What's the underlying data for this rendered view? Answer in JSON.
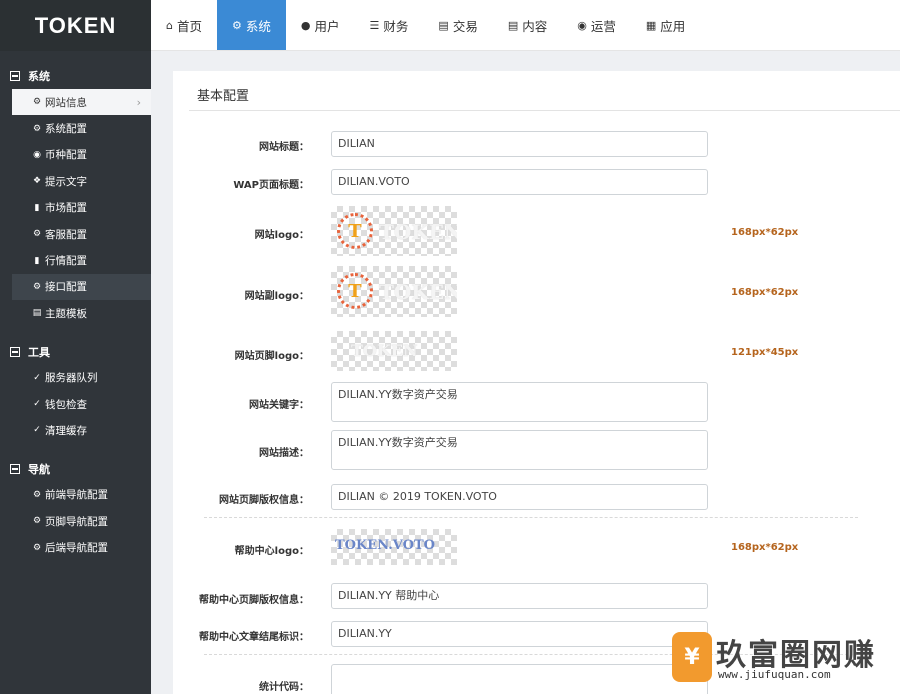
{
  "logo": "TOKEN",
  "topnav": [
    {
      "label": "首页",
      "icon": "home-icon"
    },
    {
      "label": "系统",
      "icon": "gear-icon"
    },
    {
      "label": "用户",
      "icon": "user-icon"
    },
    {
      "label": "财务",
      "icon": "list-icon"
    },
    {
      "label": "交易",
      "icon": "bar-chart-icon"
    },
    {
      "label": "内容",
      "icon": "document-icon"
    },
    {
      "label": "运营",
      "icon": "globe-icon"
    },
    {
      "label": "应用",
      "icon": "grid-icon"
    }
  ],
  "sidebar": {
    "group_system": "系统",
    "system_items": [
      "网站信息",
      "系统配置",
      "币种配置",
      "提示文字",
      "市场配置",
      "客服配置",
      "行情配置",
      "接口配置",
      "主题模板"
    ],
    "group_tools": "工具",
    "tools_items": [
      "服务器队列",
      "钱包检查",
      "清理缓存"
    ],
    "group_nav": "导航",
    "nav_items": [
      "前端导航配置",
      "页脚导航配置",
      "后端导航配置"
    ]
  },
  "panel": {
    "title": "基本配置",
    "labels": {
      "site_title": "网站标题：",
      "wap_title": "WAP页面标题：",
      "site_logo": "网站logo：",
      "site_sublogo": "网站副logo：",
      "footer_logo": "网站页脚logo：",
      "keywords": "网站关键字：",
      "description": "网站描述：",
      "copyright": "网站页脚版权信息：",
      "help_logo": "帮助中心logo：",
      "help_copyright": "帮助中心页脚版权信息：",
      "help_article_tail": "帮助中心文章结尾标识：",
      "stats_code": "统计代码："
    },
    "values": {
      "site_title": "DILIAN",
      "wap_title": "DILIAN.VOTO",
      "keywords": "DILIAN.YY数字资产交易",
      "description": "DILIAN.YY数字资产交易",
      "copyright": "DILIAN © 2019 TOKEN.VOTO",
      "help_copyright": "DILIAN.YY 帮助中心",
      "help_article_tail": "DILIAN.YY"
    },
    "logo_texts": {
      "site_logo": "TOKEN",
      "site_sublogo": "TOKEN",
      "footer_logo": "TOKEN",
      "help_logo": "TOKEN.VOTO"
    },
    "sizes": {
      "site_logo": "168px*62px",
      "site_sublogo": "168px*62px",
      "footer_logo": "121px*45px",
      "help_logo": "168px*62px"
    }
  },
  "watermark": {
    "badge": "¥",
    "title": "玖富圈网赚",
    "url": "www.jiufuquan.com"
  },
  "colors": {
    "active_nav": "#3b8ad5",
    "sidebar_bg": "#30353a",
    "size_note": "#b5641d"
  }
}
